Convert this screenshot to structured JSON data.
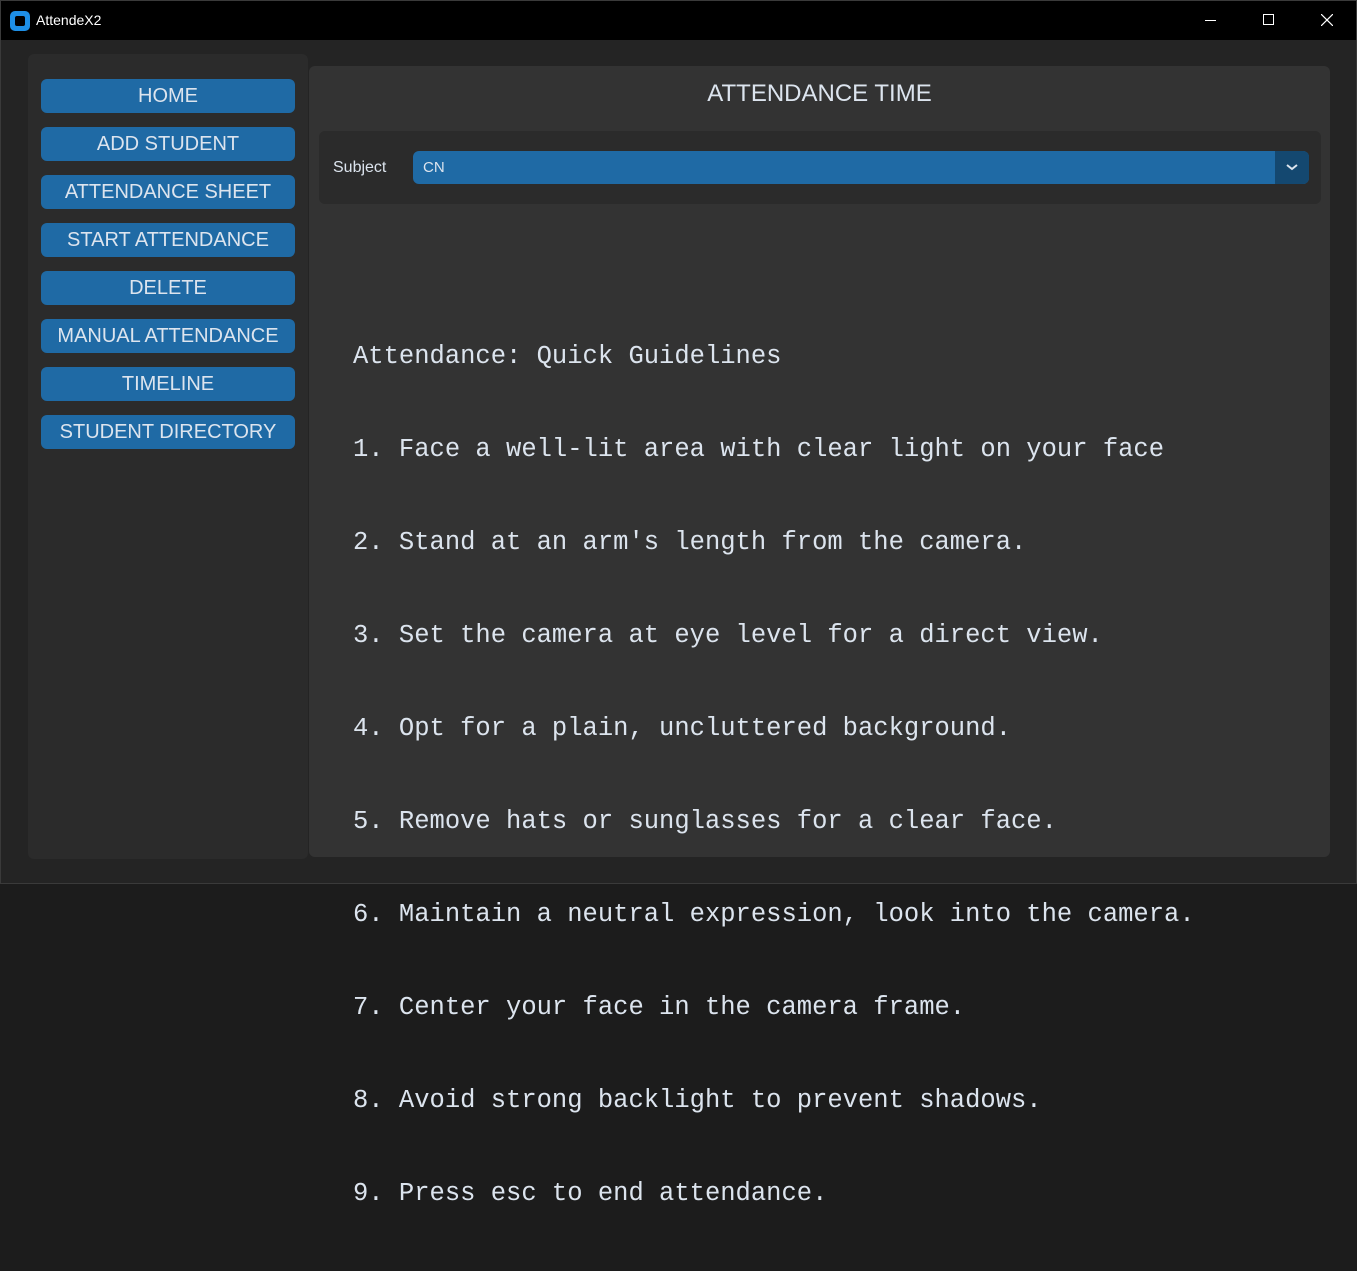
{
  "window": {
    "title": "AttendeX2"
  },
  "sidebar": {
    "items": [
      {
        "label": "HOME"
      },
      {
        "label": "ADD STUDENT"
      },
      {
        "label": "ATTENDANCE SHEET"
      },
      {
        "label": "START ATTENDANCE"
      },
      {
        "label": "DELETE"
      },
      {
        "label": "MANUAL ATTENDANCE"
      },
      {
        "label": "TIMELINE"
      },
      {
        "label": "STUDENT DIRECTORY"
      }
    ]
  },
  "main": {
    "title": "ATTENDANCE TIME",
    "subject": {
      "label": "Subject",
      "value": "CN"
    },
    "guidelines": {
      "heading": "Attendance: Quick Guidelines",
      "items": [
        "1. Face a well-lit area with clear light on your face",
        "2. Stand at an arm's length from the camera.",
        "3. Set the camera at eye level for a direct view.",
        "4. Opt for a plain, uncluttered background.",
        "5. Remove hats or sunglasses for a clear face.",
        "6. Maintain a neutral expression, look into the camera.",
        "7. Center your face in the camera frame.",
        "8. Avoid strong backlight to prevent shadows.",
        "9. Press esc to end attendance."
      ]
    }
  },
  "colors": {
    "button": "#1f6aa5",
    "button_dark": "#144870",
    "panel": "#333333",
    "sidebar": "#2b2b2b",
    "text": "#dce4ee",
    "titlebar": "#000000"
  },
  "icons": {
    "app": "app-icon",
    "minimize": "minimize-icon",
    "maximize": "maximize-icon",
    "close": "close-icon",
    "dropdown": "chevron-down-icon"
  }
}
